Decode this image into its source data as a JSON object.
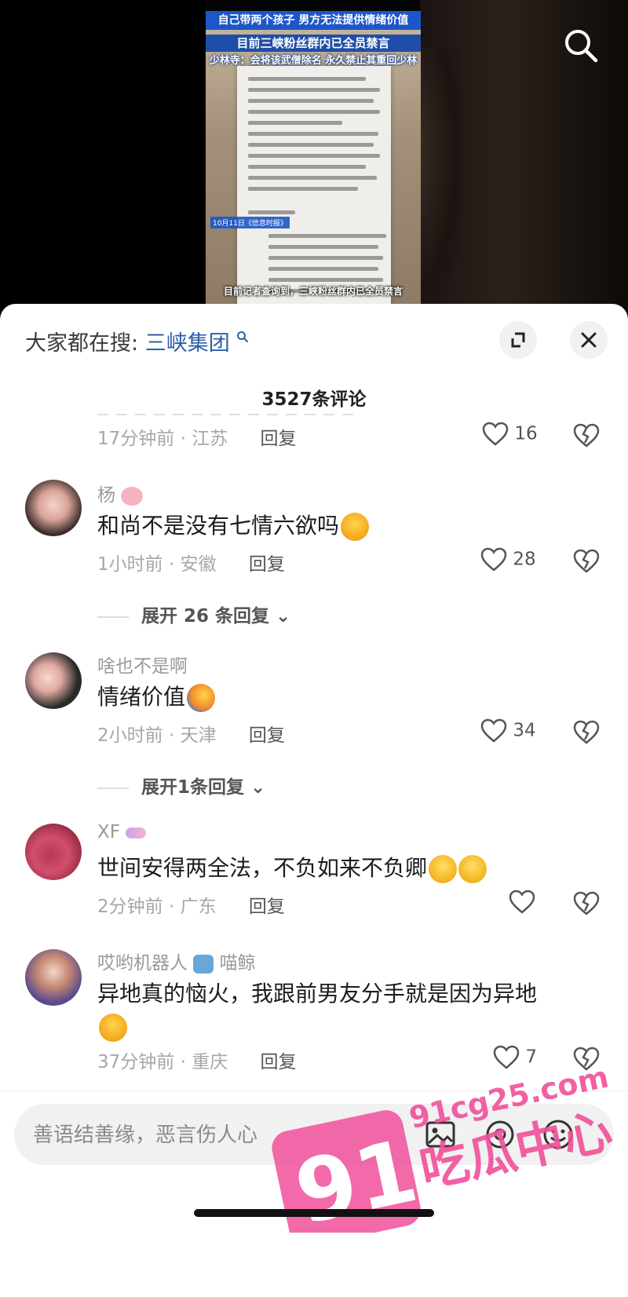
{
  "video": {
    "headline_1": "自己带两个孩子 男方无法提供情绪价值",
    "headline_2": "目前三峡粉丝群内已全员禁言",
    "headline_3": "少林寺：会将该武僧除名 永久禁止其重回少林寺",
    "date_tag": "10月11日《信息时报》",
    "bottom_caption": "目前记者查询到，三峡粉丝群内已全员禁言"
  },
  "sheet": {
    "hot_search_prefix": "大家都在搜:",
    "hot_search_term": "三峡集团",
    "comment_count": "3527条评论"
  },
  "comments": [
    {
      "username": "",
      "text": "",
      "time": "17分钟前",
      "location": "江苏",
      "reply": "回复",
      "likes": "16"
    },
    {
      "username": "杨",
      "text": "和尚不是没有七情六欲吗",
      "time": "1小时前",
      "location": "安徽",
      "reply": "回复",
      "likes": "28",
      "expand": "展开 26 条回复"
    },
    {
      "username": "啥也不是啊",
      "text": "情绪价值",
      "time": "2小时前",
      "location": "天津",
      "reply": "回复",
      "likes": "34",
      "expand": "展开1条回复"
    },
    {
      "username": "XF",
      "text": "世间安得两全法，不负如来不负卿",
      "time": "2分钟前",
      "location": "广东",
      "reply": "回复",
      "likes": ""
    },
    {
      "username": "哎哟机器人",
      "username_suffix": "喵鲸",
      "text": "异地真的恼火，我跟前男友分手就是因为异地",
      "time": "37分钟前",
      "location": "重庆",
      "reply": "回复",
      "likes": "7"
    }
  ],
  "input": {
    "placeholder": "善语结善缘，恶言伤人心"
  },
  "watermark": {
    "number": "91",
    "domain": "91cg25.com",
    "brand": "吃瓜中心"
  },
  "icons": {
    "search": "search-icon",
    "expand": "expand-icon",
    "close": "close-icon",
    "heart": "heart-icon",
    "broken_heart": "broken-heart-icon",
    "image": "image-icon",
    "at": "at-icon",
    "emoji": "emoji-icon"
  },
  "colors": {
    "link_blue": "#2c5fa8",
    "banner_blue": "#1d56c9",
    "watermark_pink": "#f0509a"
  }
}
